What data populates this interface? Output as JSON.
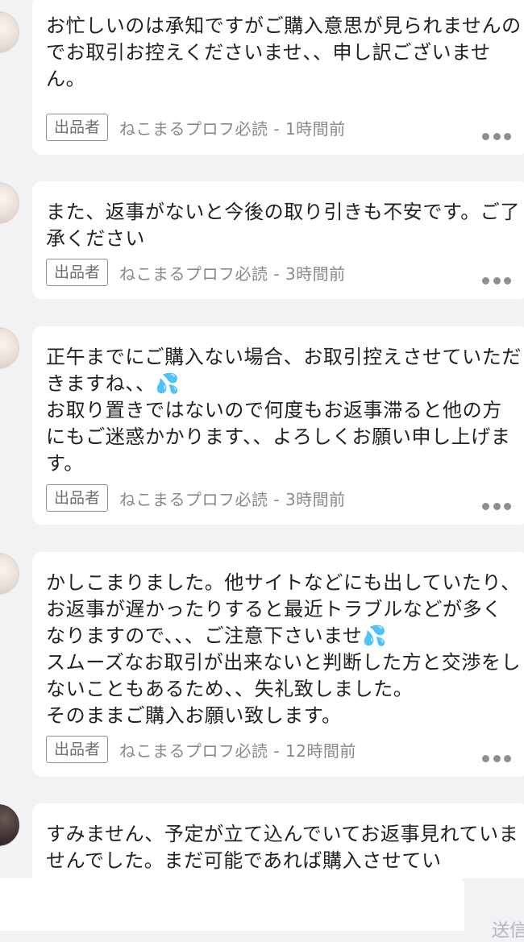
{
  "messages": [
    {
      "text": "お忙しいのは承知ですがご購入意思が見られませんのでお取引お控えくださいませ、、申し訳ございません。",
      "badge": "出品者",
      "sender": "ねこまるプロフ必読",
      "time": "1時間前"
    },
    {
      "text": "また、返事がないと今後の取り引きも不安です。ご了承ください",
      "badge": "出品者",
      "sender": "ねこまるプロフ必読",
      "time": "3時間前"
    },
    {
      "text": "正午までにご購入ない場合、お取引控えさせていただきますね、、💦\nお取り置きではないので何度もお返事滞ると他の方にもご迷惑かかります、、よろしくお願い申し上げます。",
      "badge": "出品者",
      "sender": "ねこまるプロフ必読",
      "time": "3時間前"
    },
    {
      "text": "かしこまりました。他サイトなどにも出していたり、お返事が遅かったりすると最近トラブルなどが多くなりますので、、、ご注意下さいませ💦\nスムーズなお取引が出来ないと判断した方と交渉をしないこともあるため、、失礼致しました。\nそのままご購入お願い致します。",
      "badge": "出品者",
      "sender": "ねこまるプロフ必読",
      "time": "12時間前"
    },
    {
      "text": "すみません、予定が立て込んでいてお返事見れていませんでした。まだ可能であれば購入させてい"
    }
  ],
  "composer": {
    "send_label": "送信"
  }
}
